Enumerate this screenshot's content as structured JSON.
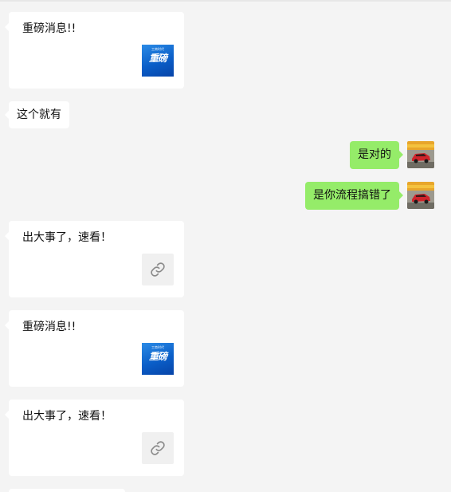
{
  "messages": [
    {
      "type": "card",
      "side": "left",
      "title": "重磅消息!!",
      "thumb_kicker": "工商时代",
      "thumb_text": "重磅",
      "thumb_icon": "news-image"
    },
    {
      "type": "text",
      "side": "left",
      "text": "这个就有"
    },
    {
      "type": "text",
      "side": "right",
      "text": "是对的"
    },
    {
      "type": "text",
      "side": "right",
      "text": "是你流程搞错了"
    },
    {
      "type": "card",
      "side": "left",
      "title": "出大事了，速看！",
      "thumb_icon": "link-icon"
    },
    {
      "type": "card",
      "side": "left",
      "title": "重磅消息!!",
      "thumb_kicker": "工商时代",
      "thumb_text": "重磅",
      "thumb_icon": "news-image"
    },
    {
      "type": "card",
      "side": "left",
      "title": "出大事了，速看！",
      "thumb_icon": "link-icon"
    }
  ],
  "colors": {
    "background": "#f4f4f4",
    "incoming_bubble": "#ffffff",
    "outgoing_bubble": "#95ec69",
    "news_thumb": "#0a5ec8"
  },
  "avatar": {
    "icon": "red-car-avatar"
  }
}
